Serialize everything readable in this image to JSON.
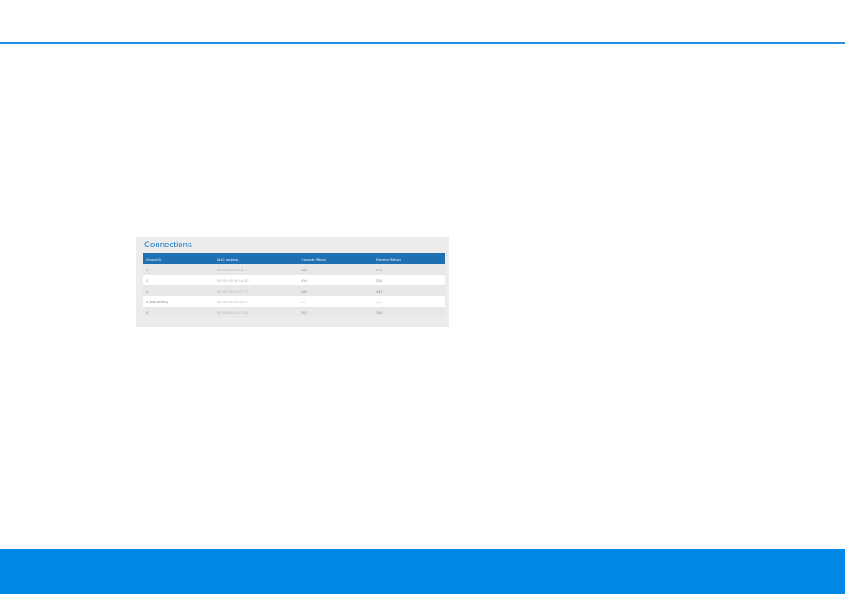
{
  "theme": {
    "accent": "#1e8fe0",
    "header_bg": "#1f6fb3",
    "footer_bg": "#0088e8"
  },
  "connections": {
    "title": "Connections",
    "columns": [
      "Device ID",
      "MAC address",
      "Transmit (Mbps)",
      "Receive (Mbps)"
    ],
    "rows": [
      [
        "1",
        "BC:05:C3:0A:1B:77",
        "256",
        "270"
      ],
      [
        "2",
        "BC:05:C3:0B:1A:5D",
        "404",
        "338"
      ],
      [
        "3",
        "BC:05:C3:0A:F7:7C",
        "296",
        "344"
      ],
      [
        "4 (this device)",
        "BC:05:C3:11:23:E1",
        "----",
        "----"
      ],
      [
        "5",
        "BC:05:C3:0A:11:D3",
        "163",
        "158"
      ]
    ]
  }
}
